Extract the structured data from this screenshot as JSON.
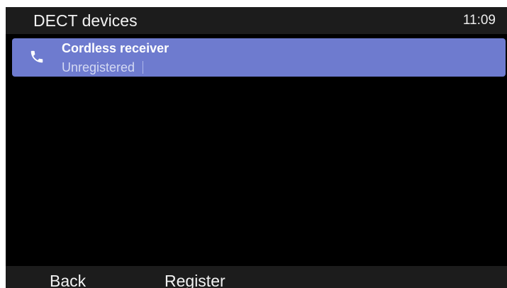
{
  "header": {
    "title": "DECT devices",
    "clock": "11:09"
  },
  "devices": [
    {
      "icon": "phone-icon",
      "name": "Cordless receiver",
      "status": "Unregistered",
      "selected": true
    }
  ],
  "softkeys": {
    "back": "Back",
    "register": "Register"
  },
  "colors": {
    "selection": "#6e7bcf",
    "background": "#000000",
    "bar": "#1c1c1c"
  }
}
